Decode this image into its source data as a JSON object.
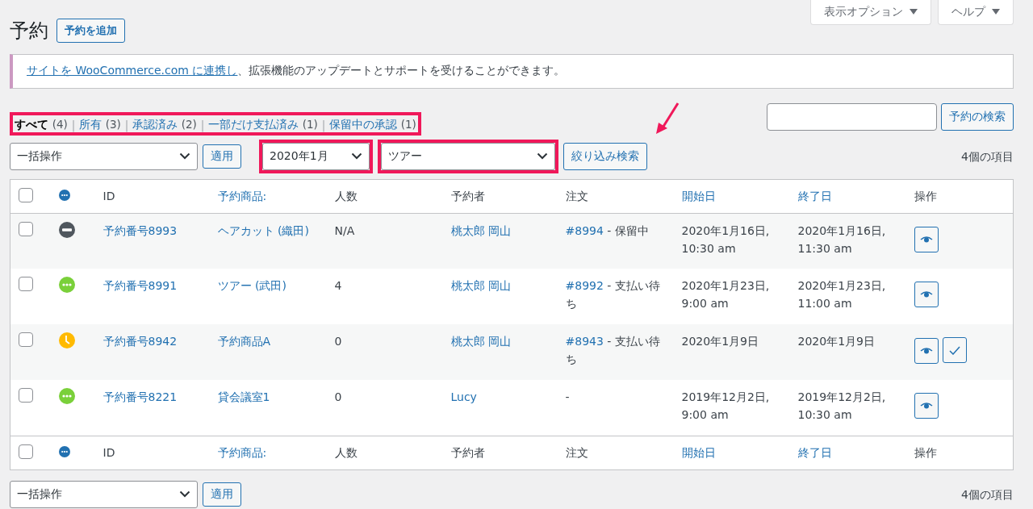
{
  "screen_options": [
    {
      "label": "表示オプション"
    },
    {
      "label": "ヘルプ"
    }
  ],
  "title": "予約",
  "add_button": "予約を追加",
  "notice": {
    "link": "サイトを WooCommerce.com に連携し",
    "text": "、拡張機能のアップデートとサポートを受けることができます。"
  },
  "views": [
    {
      "label": "すべて",
      "count": "(4)",
      "selected": true
    },
    {
      "separator": "|",
      "label": "所有",
      "count": "(3)",
      "selected": false
    },
    {
      "separator": "|",
      "label": "承認済み",
      "count": "(2)",
      "selected": false
    },
    {
      "separator": "|",
      "label": "一部だけ支払済み",
      "count": "(1)",
      "selected": false
    },
    {
      "separator": "|",
      "label": "保留中の承認",
      "count": "(1)",
      "selected": false
    }
  ],
  "search": {
    "button": "予約の検索"
  },
  "top_nav": {
    "bulk_action": "一括操作",
    "apply": "適用",
    "month_filter": "2020年1月",
    "product_filter": "ツアー",
    "filter_button": "絞り込み検索",
    "count": "4個の項目"
  },
  "table": {
    "select_all_checked": false,
    "columns": [
      {
        "label": "ID",
        "sortable": false
      },
      {
        "label": "予約商品:",
        "sortable": true
      },
      {
        "label": "人数",
        "sortable": false
      },
      {
        "label": "予約者",
        "sortable": false
      },
      {
        "label": "注文",
        "sortable": false
      },
      {
        "label": "開始日",
        "sortable": true
      },
      {
        "label": "終了日",
        "sortable": true
      },
      {
        "label": "操作",
        "sortable": false
      }
    ],
    "rows": [
      {
        "checked": false,
        "status": {
          "kind": "cancelled"
        },
        "id": "予約番号8993",
        "product": "ヘアカット (織田)",
        "persons": "N/A",
        "booker": "桃太郎 岡山",
        "order_number": "#8994",
        "order_rest": "- 保留中",
        "start": "2020年1月16日, 10:30 am",
        "end": "2020年1月16日, 11:30 am",
        "actions": [
          {
            "kind": "view"
          }
        ]
      },
      {
        "checked": false,
        "status": {
          "kind": "confirmed"
        },
        "id": "予約番号8991",
        "product": "ツアー (武田)",
        "persons": "4",
        "booker": "桃太郎 岡山",
        "order_number": "#8992",
        "order_rest": "- 支払い待ち",
        "start": "2020年1月23日, 9:00 am",
        "end": "2020年1月23日, 11:00 am",
        "actions": [
          {
            "kind": "view"
          }
        ]
      },
      {
        "checked": false,
        "status": {
          "kind": "pending"
        },
        "id": "予約番号8942",
        "product": "予約商品A",
        "persons": "0",
        "booker": "桃太郎 岡山",
        "order_number": "#8943",
        "order_rest": "- 支払い待ち",
        "start": "2020年1月9日",
        "end": "2020年1月9日",
        "actions": [
          {
            "kind": "view"
          },
          {
            "kind": "confirm"
          }
        ]
      },
      {
        "checked": false,
        "status": {
          "kind": "confirmed"
        },
        "id": "予約番号8221",
        "product": "貸会議室1",
        "persons": "0",
        "booker": "Lucy",
        "order_rest": "-",
        "start": "2019年12月2日, 9:00 am",
        "end": "2019年12月2日, 10:30 am",
        "actions": [
          {
            "kind": "view"
          }
        ]
      }
    ],
    "footer_select_all_checked": false,
    "footer_columns": [
      {
        "label": "ID",
        "sortable": false
      },
      {
        "label": "予約商品:",
        "sortable": true
      },
      {
        "label": "人数",
        "sortable": false
      },
      {
        "label": "予約者",
        "sortable": false
      },
      {
        "label": "注文",
        "sortable": false
      },
      {
        "label": "開始日",
        "sortable": true
      },
      {
        "label": "終了日",
        "sortable": true
      },
      {
        "label": "操作",
        "sortable": false
      }
    ]
  },
  "bottom_nav": {
    "bulk_action": "一括操作",
    "apply": "適用",
    "count": "4個の項目"
  }
}
